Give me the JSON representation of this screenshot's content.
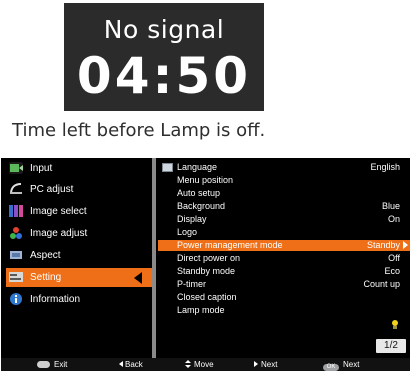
{
  "notice": {
    "title": "No signal",
    "timer": "04:50",
    "caption": "Time left before Lamp is off."
  },
  "left_menu": {
    "items": [
      {
        "label": "Input",
        "icon": "input-icon",
        "color": "#5db85b"
      },
      {
        "label": "PC adjust",
        "icon": "pc-adjust-icon",
        "color": "#d8d8d8"
      },
      {
        "label": "Image select",
        "icon": "image-select-icon",
        "color": "#3a6fd0"
      },
      {
        "label": "Image adjust",
        "icon": "image-adjust-icon",
        "color": "#e0432c"
      },
      {
        "label": "Aspect",
        "icon": "aspect-icon",
        "color": "#9db4d6"
      },
      {
        "label": "Setting",
        "icon": "setting-icon",
        "color": "#c8c8c8",
        "active": true
      },
      {
        "label": "Information",
        "icon": "information-icon",
        "color": "#2f78d2"
      }
    ]
  },
  "right_menu": {
    "rows": [
      {
        "label": "Language",
        "value": "English"
      },
      {
        "label": "Menu position",
        "value": ""
      },
      {
        "label": "Auto setup",
        "value": ""
      },
      {
        "label": "Background",
        "value": "Blue"
      },
      {
        "label": "Display",
        "value": "On"
      },
      {
        "label": "Logo",
        "value": ""
      },
      {
        "label": "Power management mode",
        "value": "Standby",
        "selected": true
      },
      {
        "label": "Direct power on",
        "value": "Off"
      },
      {
        "label": "Standby mode",
        "value": "Eco"
      },
      {
        "label": "P-timer",
        "value": "Count up"
      },
      {
        "label": "Closed caption",
        "value": ""
      },
      {
        "label": "Lamp mode",
        "value": ""
      }
    ],
    "lamp_mode_icon": "bulb-icon",
    "page": "1/2"
  },
  "footer": {
    "exit": "Exit",
    "back": "Back",
    "move": "Move",
    "next": "Next",
    "ok_label": "OK",
    "ok_next": "Next"
  },
  "colors": {
    "accent": "#ee6f17",
    "osd_background": "#000000",
    "notice_background": "#2b2b2b"
  }
}
